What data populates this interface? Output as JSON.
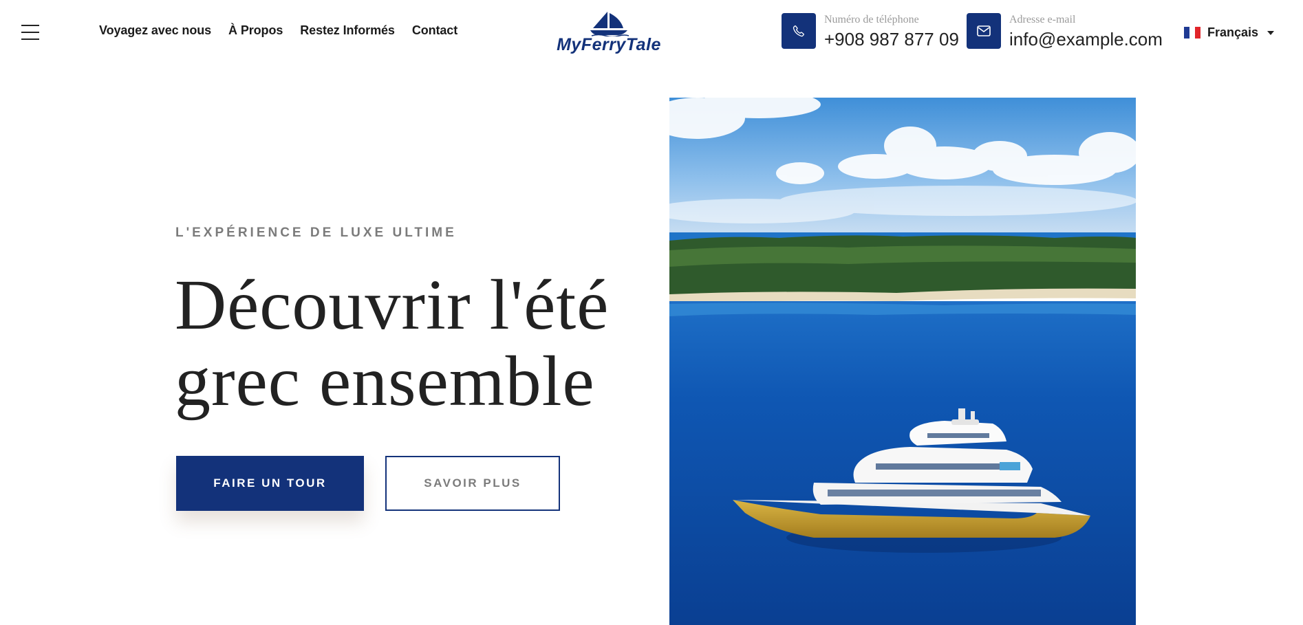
{
  "header": {
    "menu_icon": "hamburger-menu-icon",
    "nav": [
      {
        "label": "Voyagez avec nous"
      },
      {
        "label": "À Propos"
      },
      {
        "label": "Restez Informés"
      },
      {
        "label": "Contact"
      }
    ],
    "logo": {
      "text": "MyFerryTale",
      "icon": "sailboat-icon"
    },
    "phone": {
      "label": "Numéro de téléphone",
      "value": "+908 987 877 09",
      "icon": "phone-icon"
    },
    "email": {
      "label": "Adresse e-mail",
      "value": "info@example.com",
      "icon": "envelope-icon"
    },
    "language": {
      "label": "Français",
      "icon": "france-flag-icon"
    }
  },
  "hero": {
    "eyebrow": "L'EXPÉRIENCE DE LUXE ULTIME",
    "headline_line1": "Découvrir l'été",
    "headline_line2": "grec ensemble",
    "primary_button": "FAIRE UN TOUR",
    "secondary_button": "SAVOIR PLUS",
    "image": "yacht-near-tropical-island-photo"
  },
  "colors": {
    "brand_navy": "#13327a",
    "text_dark": "#222222",
    "text_muted": "#7b7b7b",
    "flag_blue": "#1f3a93",
    "flag_white": "#ffffff",
    "flag_red": "#e1252a"
  }
}
